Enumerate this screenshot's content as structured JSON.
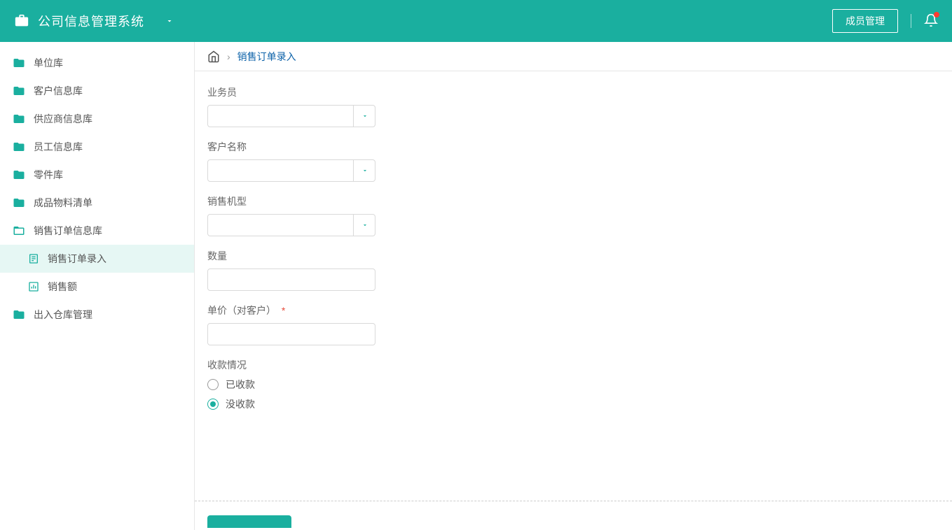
{
  "header": {
    "app_title": "公司信息管理系统",
    "member_btn": "成员管理"
  },
  "sidebar": {
    "items": [
      {
        "label": "单位库",
        "type": "folder"
      },
      {
        "label": "客户信息库",
        "type": "folder"
      },
      {
        "label": "供应商信息库",
        "type": "folder"
      },
      {
        "label": "员工信息库",
        "type": "folder"
      },
      {
        "label": "零件库",
        "type": "folder"
      },
      {
        "label": "成品物料清单",
        "type": "folder"
      },
      {
        "label": "销售订单信息库",
        "type": "folder",
        "expanded": true
      },
      {
        "label": "销售订单录入",
        "type": "sub",
        "icon": "form",
        "active": true
      },
      {
        "label": "销售额",
        "type": "sub",
        "icon": "chart",
        "active": false
      },
      {
        "label": "出入仓库管理",
        "type": "folder"
      }
    ]
  },
  "breadcrumb": {
    "current": "销售订单录入"
  },
  "form": {
    "salesperson": {
      "label": "业务员",
      "value": ""
    },
    "customer": {
      "label": "客户名称",
      "value": ""
    },
    "model": {
      "label": "销售机型",
      "value": ""
    },
    "quantity": {
      "label": "数量",
      "value": ""
    },
    "price": {
      "label": "单价（对客户）",
      "value": "",
      "required": true
    },
    "payment": {
      "label": "收款情况",
      "options": [
        {
          "label": "已收款",
          "checked": false
        },
        {
          "label": "没收款",
          "checked": true
        }
      ]
    }
  }
}
